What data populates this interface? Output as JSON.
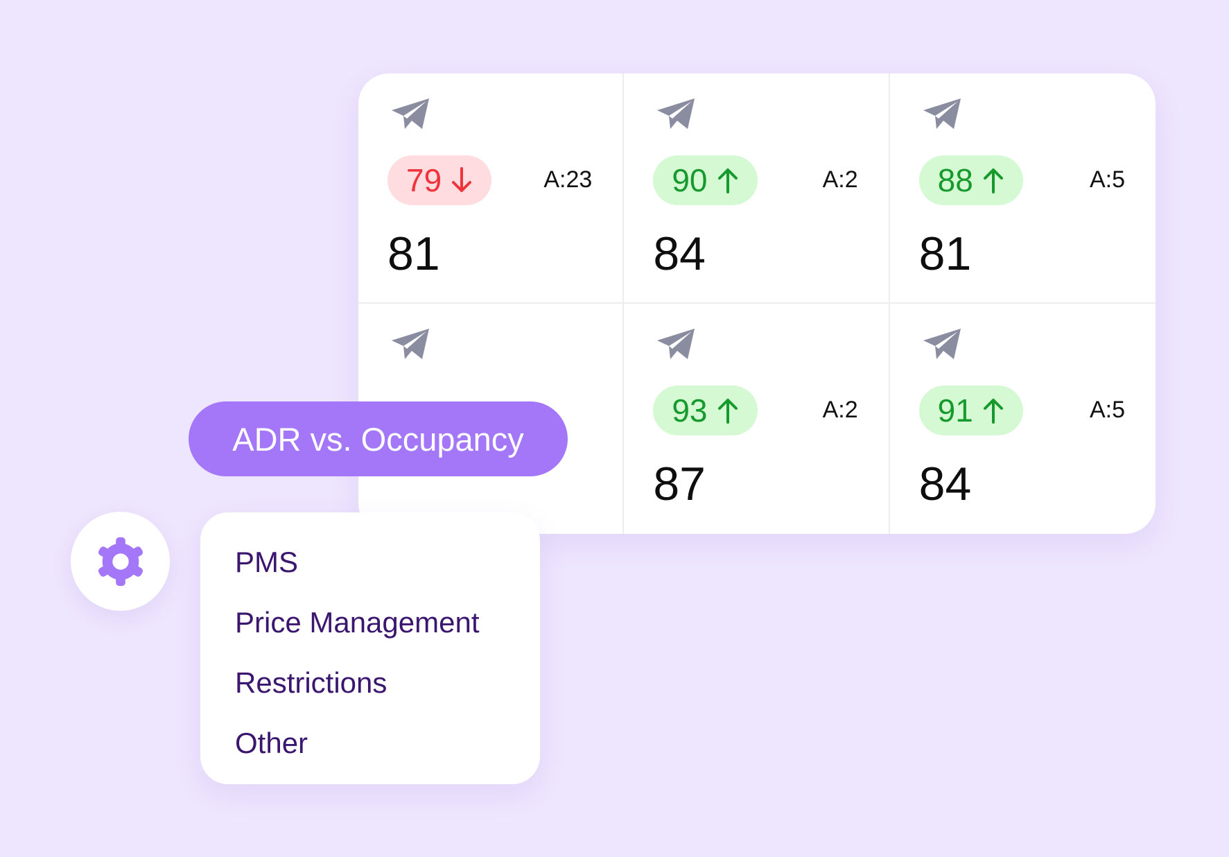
{
  "colors": {
    "background": "#EEE5FE",
    "accent": "#A477F9",
    "up_bg": "#D5F9D2",
    "up_text": "#169A2D",
    "down_bg": "#FFDCDF",
    "down_text": "#F0343C",
    "menu_text": "#3A166F",
    "icon_gray": "#8A8CA0"
  },
  "grid": {
    "cells": [
      {
        "icon": "paper-plane-icon",
        "score": "79",
        "trend": "down",
        "availability": "A:23",
        "value": "81"
      },
      {
        "icon": "paper-plane-icon",
        "score": "90",
        "trend": "up",
        "availability": "A:2",
        "value": "84"
      },
      {
        "icon": "paper-plane-icon",
        "score": "88",
        "trend": "up",
        "availability": "A:5",
        "value": "81"
      },
      {
        "icon": "paper-plane-icon"
      },
      {
        "icon": "paper-plane-icon",
        "score": "93",
        "trend": "up",
        "availability": "A:2",
        "value": "87"
      },
      {
        "icon": "paper-plane-icon",
        "score": "91",
        "trend": "up",
        "availability": "A:5",
        "value": "84"
      }
    ]
  },
  "adr_pill": {
    "label": "ADR vs. Occupancy"
  },
  "settings": {
    "icon": "gear-icon"
  },
  "menu": {
    "items": [
      {
        "label": "PMS"
      },
      {
        "label": "Price Management"
      },
      {
        "label": "Restrictions"
      },
      {
        "label": "Other"
      }
    ]
  }
}
